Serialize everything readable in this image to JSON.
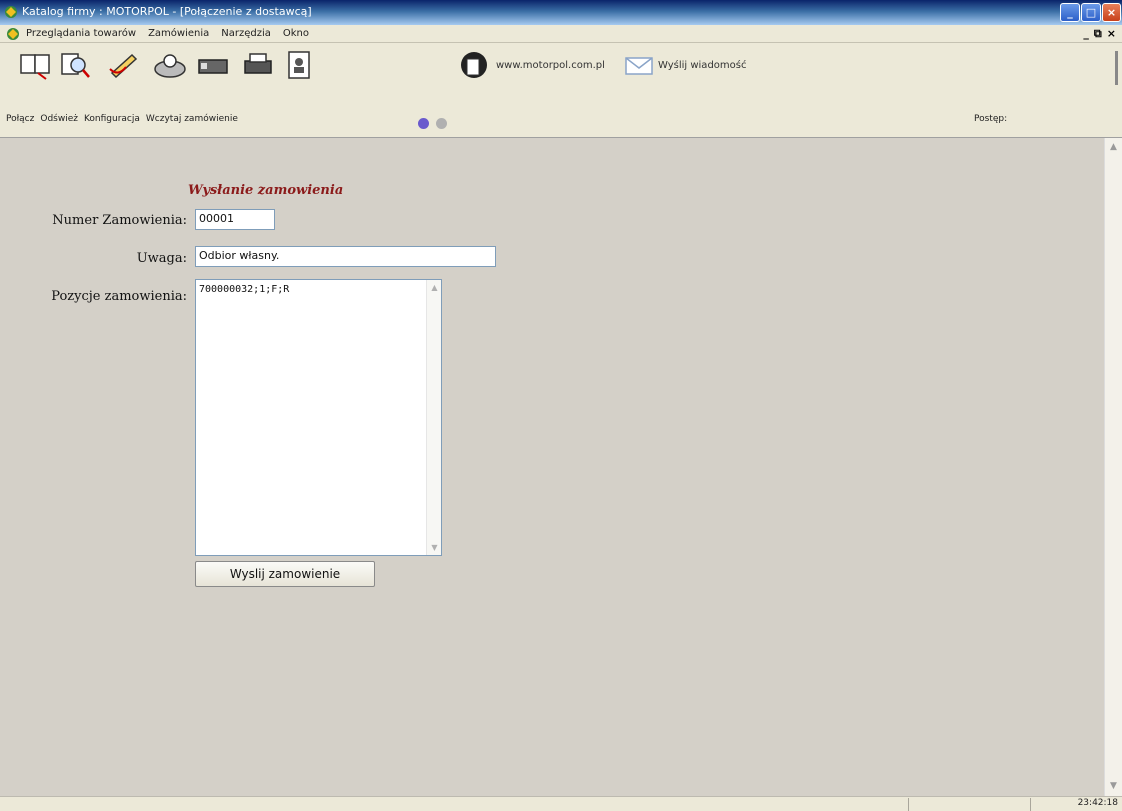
{
  "window": {
    "title": "Katalog firmy : MOTORPOL - [Połączenie z dostawcą]",
    "minimize": "_",
    "maximize": "□",
    "close": "×"
  },
  "menu": {
    "items": [
      "Przeglądania towarów",
      "Zamówienia",
      "Narzędzia",
      "Okno"
    ],
    "mdi_minimize": "_",
    "mdi_restore": "⧉",
    "mdi_close": "×"
  },
  "toolbar": {
    "url": "www.motorpol.com.pl",
    "send_message": "Wyślij wiadomość"
  },
  "toolbar2": {
    "links": [
      "Połącz",
      "Odśwież",
      "Konfiguracja",
      "Wczytaj zamówienie"
    ],
    "progress_label": "Postęp:"
  },
  "form": {
    "heading": "Wysłanie zamowienia",
    "order_number_label": "Numer Zamowienia:",
    "order_number_value": "00001",
    "note_label": "Uwaga:",
    "note_value": "Odbior własny.",
    "positions_label": "Pozycje zamowienia:",
    "positions_value": "700000032;1;F;R",
    "send_button": "Wyslij zamowienie"
  },
  "status": {
    "time": "23:42:18"
  },
  "colors": {
    "heading": "#8b1a1a",
    "window_bg": "#d4d0c8",
    "titlebar": "#0a246a"
  }
}
